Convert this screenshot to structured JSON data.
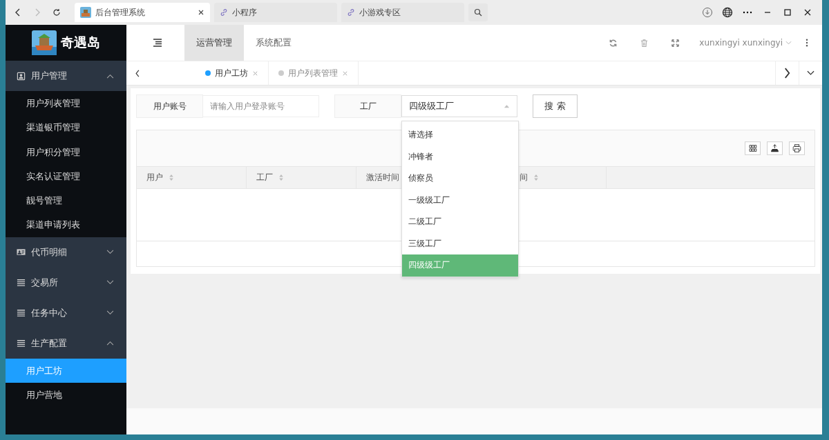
{
  "browser": {
    "tabs": [
      {
        "title": "后台管理系统",
        "kind": "page",
        "selected": true
      },
      {
        "title": "小程序",
        "kind": "link",
        "selected": false
      },
      {
        "title": "小游戏专区",
        "kind": "link",
        "selected": false
      }
    ]
  },
  "sidebar": {
    "logo": "奇遇岛",
    "items": [
      {
        "label": "用户管理",
        "kind": "person",
        "expanded": true,
        "children": [
          {
            "label": "用户列表管理",
            "selected": false
          },
          {
            "label": "渠道银币管理",
            "selected": false
          },
          {
            "label": "用户积分管理",
            "selected": false
          },
          {
            "label": "实名认证管理",
            "selected": false
          },
          {
            "label": "靓号管理",
            "selected": false
          },
          {
            "label": "渠道申请列表",
            "selected": false
          }
        ]
      },
      {
        "label": "代币明细",
        "kind": "card",
        "expanded": false
      },
      {
        "label": "交易所",
        "kind": "list",
        "expanded": false
      },
      {
        "label": "任务中心",
        "kind": "list",
        "expanded": false
      },
      {
        "label": "生产配置",
        "kind": "list",
        "expanded": true,
        "children": [
          {
            "label": "用户工坊",
            "selected": true
          },
          {
            "label": "用户营地",
            "selected": false
          }
        ]
      }
    ]
  },
  "header": {
    "tabs": [
      {
        "label": "运营管理",
        "selected": true
      },
      {
        "label": "系统配置",
        "selected": false
      }
    ],
    "user": "xunxingyi xunxingyi"
  },
  "page_tabs": [
    {
      "label": "用户工坊",
      "selected": true
    },
    {
      "label": "用户列表管理",
      "selected": false
    }
  ],
  "search": {
    "account_label": "用户账号",
    "account_placeholder": "请输入用户登录账号",
    "factory_label": "工厂",
    "factory_value": "四级级工厂",
    "button": "搜 索",
    "dropdown": {
      "open": true,
      "options": [
        {
          "label": "请选择",
          "selected": false
        },
        {
          "label": "冲锋者",
          "selected": false
        },
        {
          "label": "侦察员",
          "selected": false
        },
        {
          "label": "一级级工厂",
          "selected": false
        },
        {
          "label": "二级工厂",
          "selected": false
        },
        {
          "label": "三级工厂",
          "selected": false
        },
        {
          "label": "四级级工厂",
          "selected": true
        }
      ]
    }
  },
  "table": {
    "columns": [
      {
        "label": "用户",
        "sortable": true
      },
      {
        "label": "工厂",
        "sortable": true
      },
      {
        "label": "激活时间"
      },
      {
        "label": "间",
        "sortable": true
      }
    ]
  }
}
